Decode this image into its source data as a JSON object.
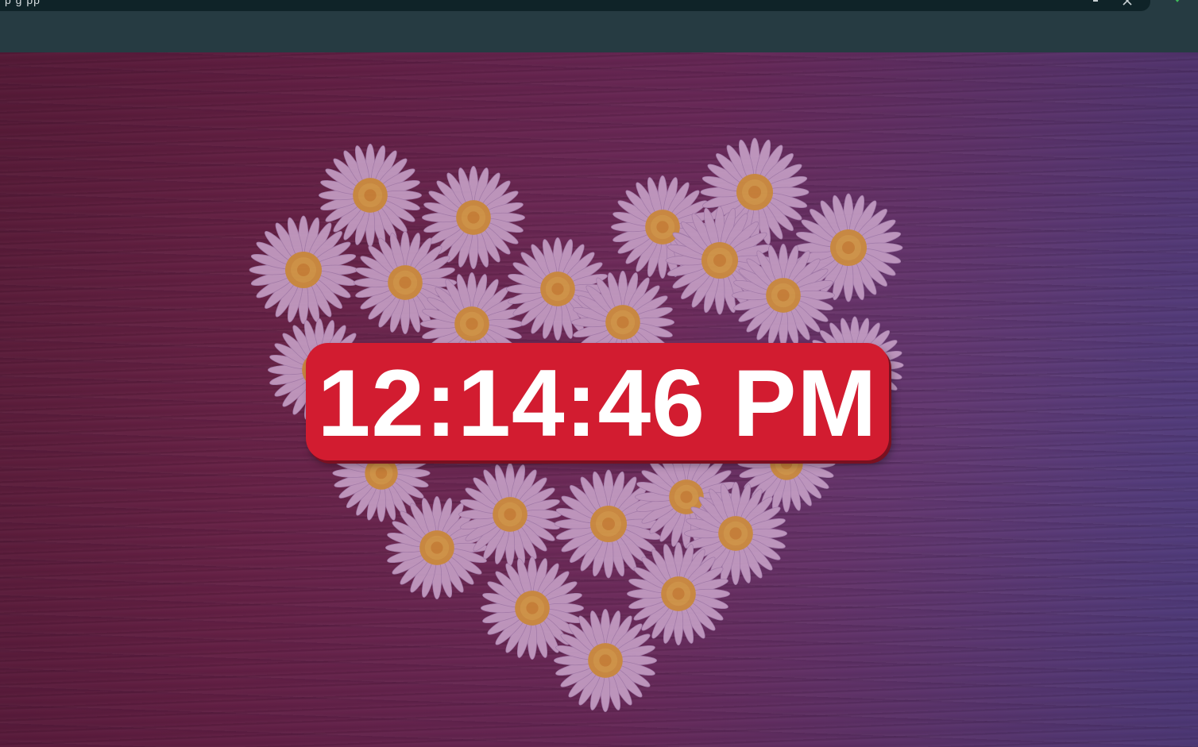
{
  "browser": {
    "address_text": "p    g    pp",
    "icons": [
      "download-icon",
      "close-icon",
      "shield-icon"
    ]
  },
  "clock": {
    "time": "12:14:46 PM"
  },
  "colors": {
    "clock_background": "#d21c30",
    "clock_text": "#ffffff",
    "browser_bar": "#263b42"
  }
}
